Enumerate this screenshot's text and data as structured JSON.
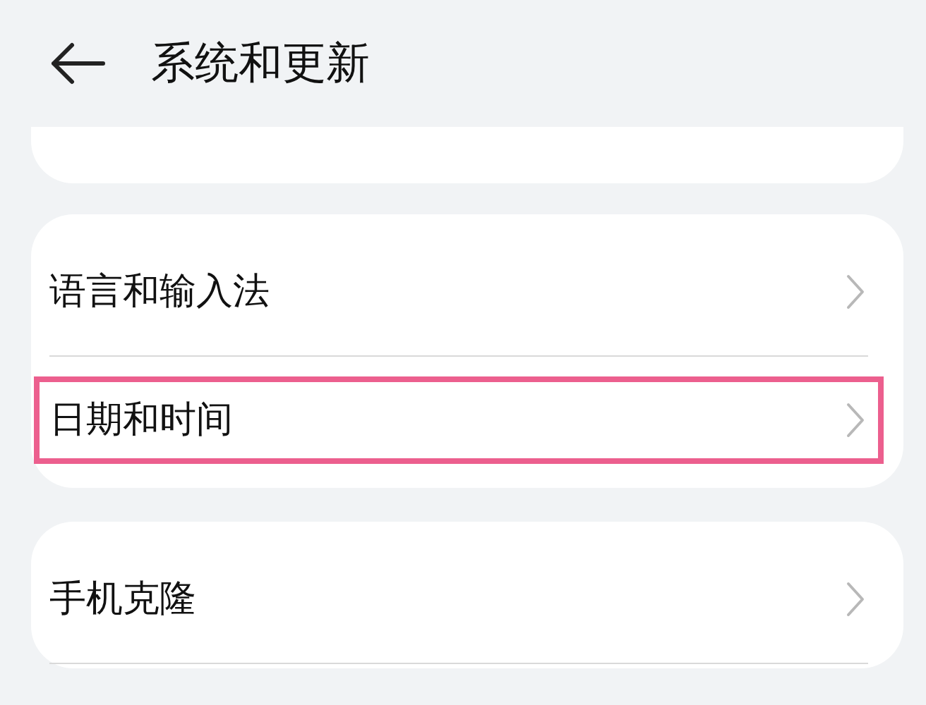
{
  "header": {
    "title": "系统和更新"
  },
  "groups": [
    {
      "items": [
        {
          "label": "语言和输入法",
          "highlighted": false
        },
        {
          "label": "日期和时间",
          "highlighted": true
        }
      ]
    },
    {
      "items": [
        {
          "label": "手机克隆",
          "highlighted": false
        }
      ]
    }
  ]
}
